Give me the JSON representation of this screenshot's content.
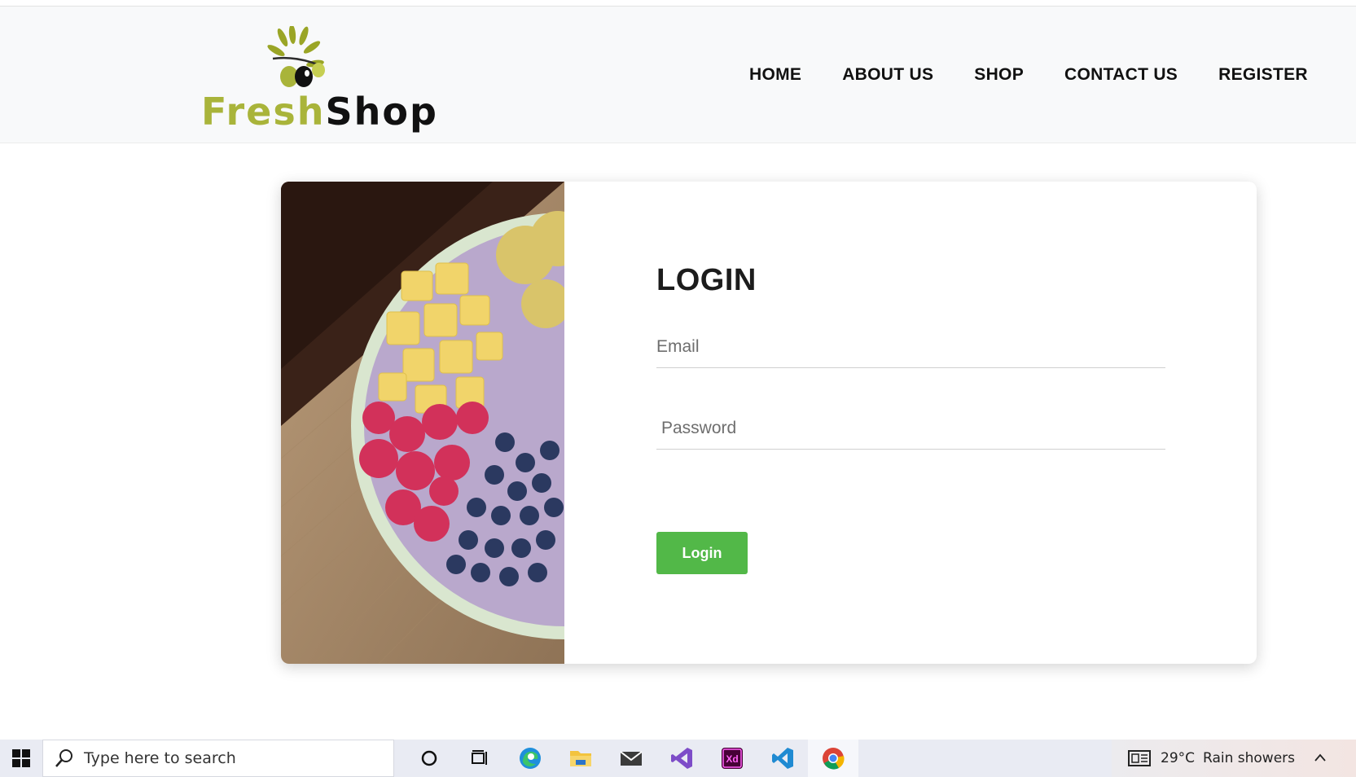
{
  "brand": {
    "name_part1": "Fresh",
    "name_part2": "Shop"
  },
  "nav": {
    "items": [
      {
        "label": "HOME"
      },
      {
        "label": "ABOUT US"
      },
      {
        "label": "SHOP"
      },
      {
        "label": "CONTACT US"
      },
      {
        "label": "REGISTER"
      }
    ]
  },
  "login": {
    "title": "LOGIN",
    "email_placeholder": "Email",
    "email_value": "",
    "password_placeholder": "Password",
    "password_value": "",
    "button_label": "Login"
  },
  "colors": {
    "accent": "#52b848",
    "brand_green": "#a9b43a",
    "header_bg": "#f8f9fa"
  },
  "taskbar": {
    "search_placeholder": "Type here to search",
    "apps": [
      "cortana-icon",
      "task-view-icon",
      "edge-icon",
      "file-explorer-icon",
      "mail-icon",
      "visual-studio-icon",
      "adobe-xd-icon",
      "vscode-icon",
      "chrome-icon"
    ],
    "weather_temp": "29°C",
    "weather_text": "Rain showers"
  }
}
